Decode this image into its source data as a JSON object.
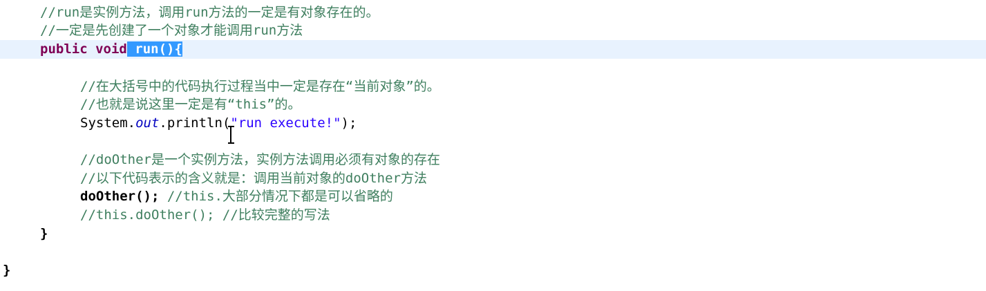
{
  "lines": {
    "l1": {
      "comment": "//run是实例方法，调用run方法的一定是有对象存在的。"
    },
    "l2": {
      "comment": "//一定是先创建了一个对象才能调用run方法"
    },
    "l3": {
      "kw1": "public",
      "kw2": "void",
      "selected": " run(){"
    },
    "l4": {
      "comment": "//在大括号中的代码执行过程当中一定是存在“当前对象”的。"
    },
    "l5": {
      "comment": "//也就是说这里一定是有“this”的。"
    },
    "l6": {
      "system": "System.",
      "field": "out",
      "method": ".println(",
      "string": "\"run execute!\"",
      "end": ");"
    },
    "l7": {
      "comment": "//doOther是一个实例方法，实例方法调用必须有对象的存在"
    },
    "l8": {
      "comment": "//以下代码表示的含义就是：调用当前对象的doOther方法"
    },
    "l9": {
      "call": "doOther();",
      "comment": " //this.大部分情况下都是可以省略的"
    },
    "l10": {
      "comment": "//this.doOther(); //比较完整的写法"
    },
    "l11": {
      "brace": "}"
    },
    "l12": {
      "brace": "}"
    }
  },
  "cursor_icon": "text-cursor-icon"
}
